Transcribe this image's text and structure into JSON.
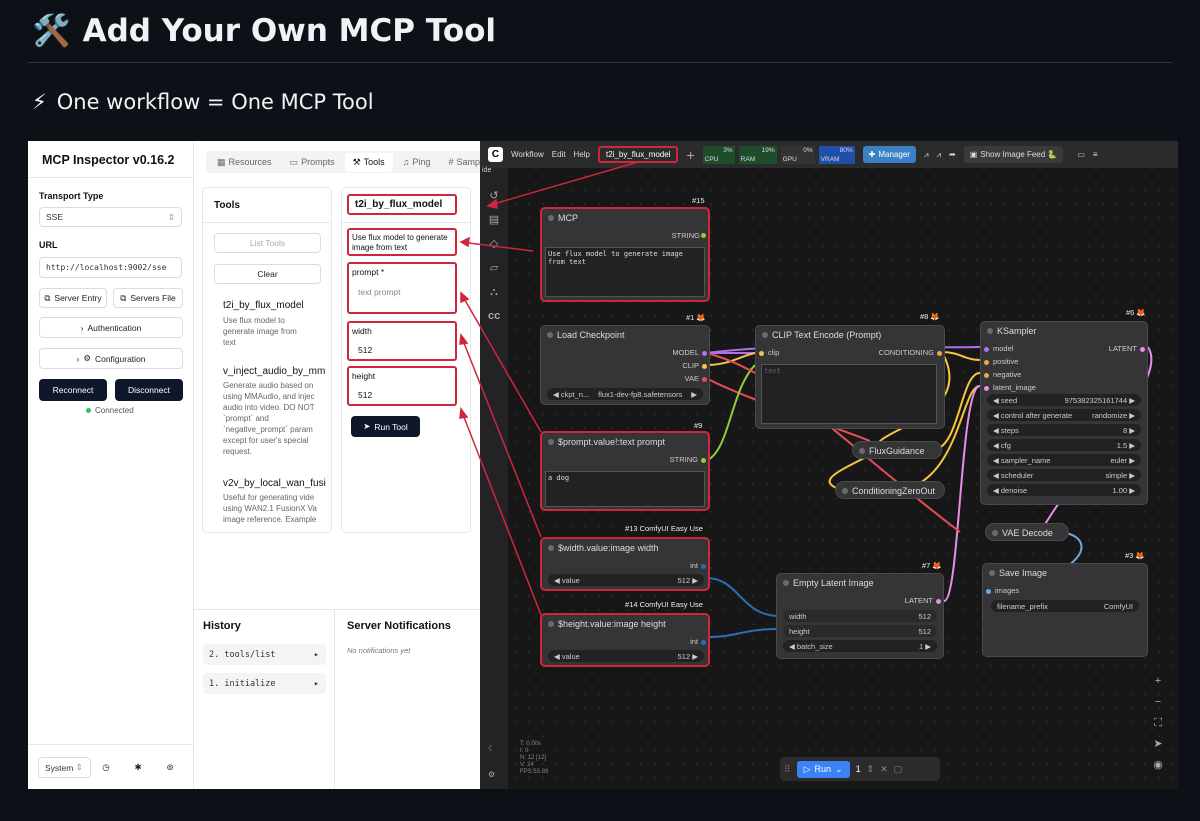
{
  "heading": {
    "icon": "🛠️",
    "title": "Add Your Own MCP Tool"
  },
  "subheading": {
    "icon": "⚡",
    "text": "One workflow = One MCP Tool"
  },
  "inspector": {
    "title": "MCP Inspector v0.16.2",
    "transport_label": "Transport Type",
    "transport_value": "SSE",
    "url_label": "URL",
    "url_value": "http://localhost:9002/sse",
    "server_entry": "Server Entry",
    "servers_file": "Servers File",
    "authentication": "Authentication",
    "configuration": "Configuration",
    "reconnect": "Reconnect",
    "disconnect": "Disconnect",
    "status": "Connected",
    "theme": "System"
  },
  "tabs": [
    "Resources",
    "Prompts",
    "Tools",
    "Ping",
    "Sampl"
  ],
  "tools_panel": {
    "title": "Tools",
    "list_tools": "List Tools",
    "clear": "Clear",
    "items": [
      {
        "name": "t2i_by_flux_model",
        "desc": [
          "Use flux model to",
          "generate image from",
          "text"
        ]
      },
      {
        "name": "v_inject_audio_by_mm",
        "desc": [
          "Generate audio based on",
          "using MMAudio, and injec",
          "audio into video. DO NOT",
          "`prompt` and",
          "`negative_prompt` param",
          "except for user's special",
          "request."
        ]
      },
      {
        "name": "v2v_by_local_wan_fusi",
        "desc": [
          "Useful for generating vide",
          "using WAN2.1 FusionX Va",
          "image reference. Example"
        ]
      }
    ]
  },
  "tool_detail": {
    "name": "t2i_by_flux_model",
    "desc": "Use flux model to generate image from text",
    "prompt_label": "prompt *",
    "prompt_placeholder": "text prompt",
    "width_label": "width",
    "width_value": "512",
    "height_label": "height",
    "height_value": "512",
    "run": "Run Tool"
  },
  "history": {
    "title": "History",
    "items": [
      "2. tools/list",
      "1. initialize"
    ]
  },
  "notifications": {
    "title": "Server Notifications",
    "empty": "No notifications yet"
  },
  "comfy": {
    "menu": [
      "Workflow",
      "Edit",
      "Help"
    ],
    "active_tab": "t2i_by_flux_model",
    "side_label": "ide",
    "cpu": "CPU",
    "cpu_val": "3%",
    "ram": "RAM",
    "ram_val": "19%",
    "gpu": "GPU",
    "gpu_val": "0%",
    "vram": "VRAM",
    "vram_val": "80%",
    "manager": "Manager",
    "show_feed": "Show Image Feed 🐍",
    "stats": [
      "T: 0.00s",
      "I: 0",
      "N: 12 [12]",
      "V: 24",
      "FPS:53.89"
    ],
    "run": "Run",
    "run_count": "1",
    "nodes": {
      "mcp": {
        "id": "#15",
        "title": "MCP",
        "out": "STRING",
        "text": "Use flux model to generate image from text"
      },
      "ckpt": {
        "id": "#1 🦊",
        "title": "Load Checkpoint",
        "outs": [
          "MODEL",
          "CLIP",
          "VAE"
        ],
        "widget_label": "ckpt_n...",
        "widget_value": "flux1-dev-fp8.safetensors"
      },
      "prompt": {
        "id": "#9",
        "title": "$prompt.value!:text prompt",
        "out": "STRING",
        "text": "a dog"
      },
      "width": {
        "id": "#13 ComfyUI Easy Use",
        "title": "$width.value:image width",
        "out": "int",
        "label": "value",
        "value": "512"
      },
      "height": {
        "id": "#14 ComfyUI Easy Use",
        "title": "$height.value:image height",
        "out": "int",
        "label": "value",
        "value": "512"
      },
      "clip": {
        "id": "#8 🦊",
        "title": "CLIP Text Encode (Prompt)",
        "in": "clip",
        "out": "CONDITIONING",
        "text": "text"
      },
      "flux": {
        "title": "FluxGuidance"
      },
      "zero": {
        "title": "ConditioningZeroOut"
      },
      "ksampler": {
        "id": "#6 🦊",
        "title": "KSampler",
        "ins": [
          "model",
          "positive",
          "negative",
          "latent_image"
        ],
        "out": "LATENT",
        "widgets": [
          [
            "seed",
            "975382325161744"
          ],
          [
            "control after generate",
            "randomize"
          ],
          [
            "steps",
            "8"
          ],
          [
            "cfg",
            "1.5"
          ],
          [
            "sampler_name",
            "euler"
          ],
          [
            "scheduler",
            "simple"
          ],
          [
            "denoise",
            "1.00"
          ]
        ]
      },
      "vae": {
        "title": "VAE Decode"
      },
      "latent": {
        "id": "#7 🦊",
        "title": "Empty Latent Image",
        "out": "LATENT",
        "widgets": [
          [
            "width",
            "512"
          ],
          [
            "height",
            "512"
          ],
          [
            "batch_size",
            "1"
          ]
        ]
      },
      "save": {
        "id": "#3 🦊",
        "title": "Save Image",
        "in": "images",
        "widget_label": "filename_prefix",
        "widget_value": "ComfyUI"
      }
    }
  }
}
